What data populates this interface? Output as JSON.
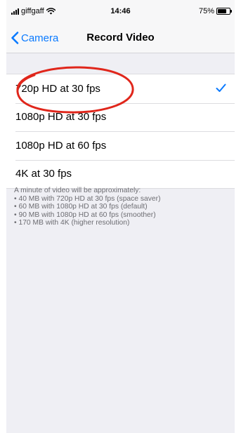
{
  "status_bar": {
    "carrier": "giffgaff",
    "time": "14:46",
    "battery_percent": "75%",
    "battery_level": 0.75
  },
  "nav": {
    "back_label": "Camera",
    "title": "Record Video"
  },
  "options": [
    {
      "label": "720p HD at 30 fps",
      "selected": true
    },
    {
      "label": "1080p HD at 30 fps",
      "selected": false
    },
    {
      "label": "1080p HD at 60 fps",
      "selected": false
    },
    {
      "label": "4K at 30 fps",
      "selected": false
    }
  ],
  "footer": {
    "intro": "A minute of video will be approximately:",
    "lines": [
      "• 40 MB with 720p HD at 30 fps (space saver)",
      "• 60 MB with 1080p HD at 30 fps (default)",
      "• 90 MB with 1080p HD at 60 fps (smoother)",
      "• 170 MB with 4K (higher resolution)"
    ]
  },
  "colors": {
    "accent": "#0a7aff",
    "annotation": "#e0261b",
    "background": "#efeff4"
  },
  "icons": [
    "signal-icon",
    "wifi-icon",
    "battery-icon",
    "chevron-left-icon",
    "checkmark-icon"
  ]
}
